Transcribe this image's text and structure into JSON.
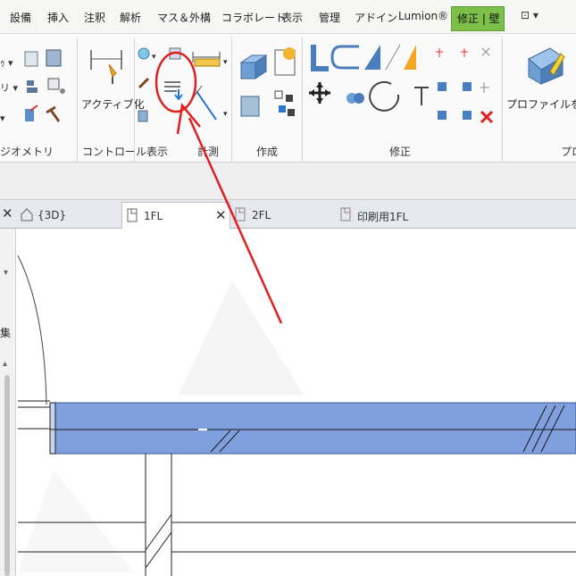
{
  "menu": {
    "items": [
      "設備",
      "挿入",
      "注釈",
      "解析",
      "マス＆外構",
      "コラボレート",
      "表示",
      "管理",
      "アドイン",
      "Lumion®"
    ],
    "active_tab": "修正 | 壁",
    "extra": "⊡ ▾"
  },
  "ribbon": {
    "geometry_label_partial": "ジオメトリ",
    "left_partial_labels": [
      "ｩ",
      "リ"
    ],
    "activate_label": "アクティブ化",
    "panels": {
      "control": "コントロール",
      "view": "表示",
      "measure": "計測",
      "create": "作成",
      "modify": "修正",
      "profile_partial": "プロ"
    },
    "edit_profile_label": "プロファイルを編集"
  },
  "views": {
    "tabs": [
      {
        "label": "{3D}",
        "active": false
      },
      {
        "label": "1FL",
        "active": true
      },
      {
        "label": "2FL",
        "active": false
      },
      {
        "label": "印刷用1FL",
        "active": false
      }
    ],
    "left_panel_text": "集"
  },
  "colors": {
    "accent_green": "#7cbf49",
    "wall_fill": "#7f9fdd",
    "annotation_red": "#e02020"
  },
  "icons": [
    "thin-lines-icon",
    "bulb-icon",
    "pin-icon",
    "dimension-icon",
    "align-icon",
    "move-icon",
    "rotate-icon",
    "delete-icon",
    "edit-profile-icon"
  ]
}
